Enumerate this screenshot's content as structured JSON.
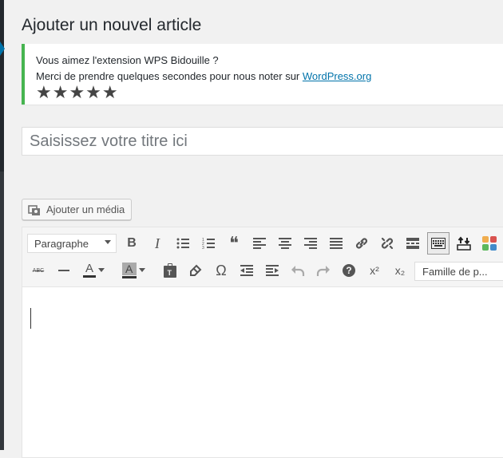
{
  "page": {
    "title": "Ajouter un nouvel article"
  },
  "notice": {
    "line1": "Vous aimez l'extension WPS Bidouille ?",
    "line2_prefix": "Merci de prendre quelques secondes pour nous noter sur ",
    "line2_link": "WordPress.org",
    "stars": "★★★★★",
    "rating": 5,
    "accent_color": "#46b450"
  },
  "title_field": {
    "placeholder": "Saisissez votre titre ici",
    "value": ""
  },
  "media": {
    "label": "Ajouter un média"
  },
  "editor": {
    "format_select": "Paragraphe",
    "font_family_select": "Famille de p...",
    "row1_icons": [
      "bold-icon",
      "italic-icon",
      "bullet-list-icon",
      "numbered-list-icon",
      "blockquote-icon",
      "align-left-icon",
      "align-center-icon",
      "align-right-icon",
      "justify-icon",
      "link-icon",
      "unlink-icon",
      "read-more-icon",
      "toolbar-toggle-icon",
      "upload-download-icon",
      "color-grid-icon"
    ],
    "row2_icons": [
      "strikethrough-icon",
      "horizontal-line-icon",
      "text-color-icon",
      "background-color-icon",
      "paste-text-icon",
      "clear-formatting-icon",
      "special-character-icon",
      "outdent-icon",
      "indent-icon",
      "undo-icon",
      "redo-icon",
      "help-icon",
      "superscript-icon",
      "subscript-icon"
    ],
    "glyphs": {
      "bold": "B",
      "italic": "I",
      "blockquote": "❝",
      "omega": "Ω",
      "help": "?",
      "sup": "x²",
      "sub": "x₂",
      "strike": "ABC",
      "text_color": "A"
    }
  }
}
